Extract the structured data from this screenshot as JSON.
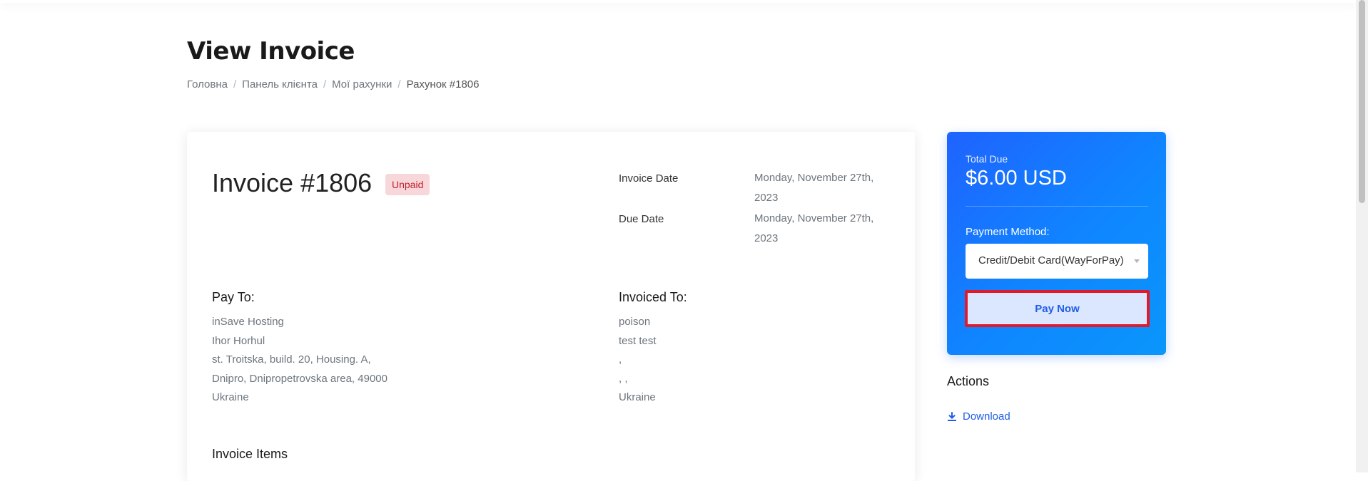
{
  "page": {
    "title": "View Invoice"
  },
  "breadcrumb": {
    "items": [
      "Головна",
      "Панель клієнта",
      "Мої рахунки"
    ],
    "current": "Рахунок #1806",
    "separator": "/"
  },
  "invoice": {
    "heading": "Invoice #1806",
    "status": "Unpaid",
    "invoice_date_label": "Invoice Date",
    "invoice_date_value": "Monday, November 27th, 2023",
    "due_date_label": "Due Date",
    "due_date_value": "Monday, November 27th, 2023",
    "pay_to": {
      "title": "Pay To:",
      "lines": [
        "inSave Hosting",
        "Ihor Horhul",
        "st. Troitska, build. 20, Housing. A,",
        "Dnipro, Dnipropetrovska area, 49000",
        "Ukraine"
      ]
    },
    "invoiced_to": {
      "title": "Invoiced To:",
      "lines": [
        "poison",
        "test test",
        ",",
        ", ,",
        "Ukraine"
      ]
    },
    "items_title": "Invoice Items"
  },
  "summary": {
    "total_label": "Total Due",
    "total_amount": "$6.00 USD",
    "payment_method_label": "Payment Method:",
    "payment_method_value": "Credit/Debit Card(WayForPay)",
    "pay_button": "Pay Now",
    "accent_color": "#1f63ff",
    "highlight_color": "#e01a2b"
  },
  "actions": {
    "title": "Actions",
    "download_label": "Download",
    "download_icon": "download-icon"
  }
}
